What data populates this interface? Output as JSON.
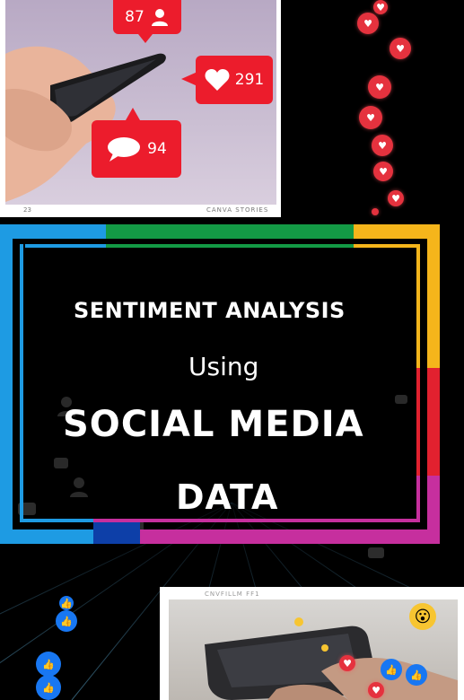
{
  "title": {
    "line1": "SENTIMENT ANALYSIS",
    "line2": "Using",
    "line3": "SOCIAL MEDIA",
    "line4": "DATA"
  },
  "photo_top": {
    "followers_count": "87",
    "likes_count": "291",
    "comments_count": "94",
    "caption_left": "23",
    "caption_right": "CANVA STORIES"
  },
  "photo_bottom": {
    "caption": "CNVFILLM FF1"
  },
  "icons": {
    "person": "person-icon",
    "heart": "heart-icon",
    "comment": "comment-icon",
    "like": "thumbs-up-icon",
    "emoji": "emoji-icon"
  },
  "colors": {
    "notification_red": "#ec1c2c",
    "frame_blue": "#1e9be3",
    "frame_green": "#139a45",
    "frame_yellow": "#f5b51b",
    "frame_red": "#e2212f",
    "frame_magenta": "#c62f9e",
    "frame_navy": "#0d3fa8"
  }
}
